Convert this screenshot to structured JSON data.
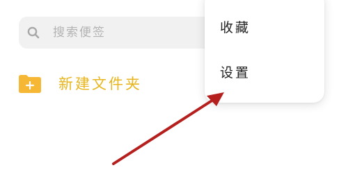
{
  "search": {
    "placeholder": "搜索便签",
    "icon": "search-icon"
  },
  "folder": {
    "label": "新建文件夹",
    "icon": "folder-add-icon",
    "accent_color": "#f6b735"
  },
  "menu": {
    "items": [
      {
        "label": "收藏"
      },
      {
        "label": "设置"
      }
    ]
  },
  "annotation": {
    "arrow_color": "#b5201e"
  }
}
